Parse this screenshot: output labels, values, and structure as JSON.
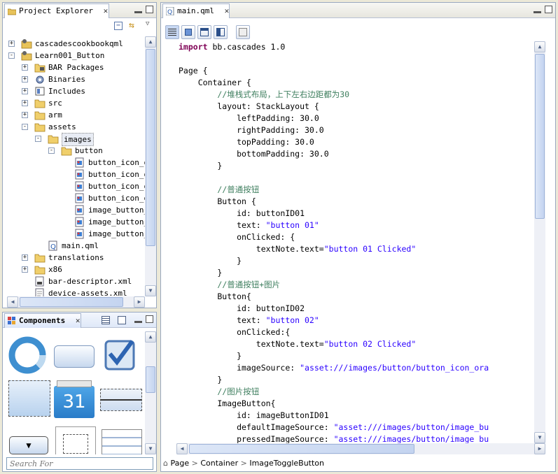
{
  "project_explorer": {
    "tab_label": "Project Explorer",
    "tree": [
      {
        "label": "cascadescookbookqml",
        "indent": 0,
        "expander": "+",
        "icon": "project-icon"
      },
      {
        "label": "Learn001_Button",
        "indent": 0,
        "expander": "-",
        "icon": "project-icon"
      },
      {
        "label": "BAR Packages",
        "indent": 1,
        "expander": "+",
        "icon": "bar-packages-icon"
      },
      {
        "label": "Binaries",
        "indent": 1,
        "expander": "+",
        "icon": "binaries-icon"
      },
      {
        "label": "Includes",
        "indent": 1,
        "expander": "+",
        "icon": "includes-icon"
      },
      {
        "label": "src",
        "indent": 1,
        "expander": "+",
        "icon": "folder-icon"
      },
      {
        "label": "arm",
        "indent": 1,
        "expander": "+",
        "icon": "folder-icon"
      },
      {
        "label": "assets",
        "indent": 1,
        "expander": "-",
        "icon": "folder-icon"
      },
      {
        "label": "images",
        "indent": 2,
        "expander": "-",
        "icon": "folder-icon",
        "selected": true
      },
      {
        "label": "button",
        "indent": 3,
        "expander": "-",
        "icon": "folder-icon"
      },
      {
        "label": "button_icon_or",
        "indent": 4,
        "expander": "",
        "icon": "image-file-icon"
      },
      {
        "label": "button_icon_or",
        "indent": 4,
        "expander": "",
        "icon": "image-file-icon"
      },
      {
        "label": "button_icon_or",
        "indent": 4,
        "expander": "",
        "icon": "image-file-icon"
      },
      {
        "label": "button_icon_or",
        "indent": 4,
        "expander": "",
        "icon": "image-file-icon"
      },
      {
        "label": "image_button_c",
        "indent": 4,
        "expander": "",
        "icon": "image-file-icon"
      },
      {
        "label": "image_button_c",
        "indent": 4,
        "expander": "",
        "icon": "image-file-icon"
      },
      {
        "label": "image_button_s",
        "indent": 4,
        "expander": "",
        "icon": "image-file-icon"
      },
      {
        "label": "main.qml",
        "indent": 2,
        "expander": "",
        "icon": "qml-file-icon"
      },
      {
        "label": "translations",
        "indent": 1,
        "expander": "+",
        "icon": "folder-icon"
      },
      {
        "label": "x86",
        "indent": 1,
        "expander": "+",
        "icon": "folder-icon"
      },
      {
        "label": "bar-descriptor.xml",
        "indent": 1,
        "expander": "",
        "icon": "xml-file-icon"
      },
      {
        "label": "device-assets.xml",
        "indent": 1,
        "expander": "",
        "icon": "file-icon"
      }
    ]
  },
  "components": {
    "tab_label": "Components",
    "search_placeholder": "Search For",
    "items": [
      "activity-indicator",
      "button",
      "checkbox",
      "container",
      "date-time-picker",
      "divider",
      "drop-down",
      "empty",
      "list-view"
    ],
    "calendar_day": "31"
  },
  "editor": {
    "tab_label": "main.qml",
    "breadcrumb": [
      "Page",
      "Container",
      "ImageToggleButton"
    ],
    "lines": [
      [
        {
          "t": "import",
          "c": "kw"
        },
        {
          "t": " bb.cascades 1.0"
        }
      ],
      [],
      [
        {
          "t": "Page {"
        }
      ],
      [
        {
          "t": "    Container {"
        }
      ],
      [
        {
          "t": "        "
        },
        {
          "t": "//堆栈式布局，上下左右边距都为30",
          "c": "cm"
        }
      ],
      [
        {
          "t": "        layout: StackLayout {"
        }
      ],
      [
        {
          "t": "            leftPadding: 30.0"
        }
      ],
      [
        {
          "t": "            rightPadding: 30.0"
        }
      ],
      [
        {
          "t": "            topPadding: 30.0"
        }
      ],
      [
        {
          "t": "            bottomPadding: 30.0"
        }
      ],
      [
        {
          "t": "        }"
        }
      ],
      [],
      [
        {
          "t": "        "
        },
        {
          "t": "//普通按钮",
          "c": "cm"
        }
      ],
      [
        {
          "t": "        Button {"
        }
      ],
      [
        {
          "t": "            id: buttonID01"
        }
      ],
      [
        {
          "t": "            text: "
        },
        {
          "t": "\"button 01\"",
          "c": "str"
        }
      ],
      [
        {
          "t": "            onClicked: {"
        }
      ],
      [
        {
          "t": "                textNote.text="
        },
        {
          "t": "\"button 01 Clicked\"",
          "c": "str"
        }
      ],
      [
        {
          "t": "            }"
        }
      ],
      [
        {
          "t": "        }"
        }
      ],
      [
        {
          "t": "        "
        },
        {
          "t": "//普通按钮+图片",
          "c": "cm"
        }
      ],
      [
        {
          "t": "        Button{"
        }
      ],
      [
        {
          "t": "            id: buttonID02"
        }
      ],
      [
        {
          "t": "            text: "
        },
        {
          "t": "\"button 02\"",
          "c": "str"
        }
      ],
      [
        {
          "t": "            onClicked:{"
        }
      ],
      [
        {
          "t": "                textNote.text="
        },
        {
          "t": "\"button 02 Clicked\"",
          "c": "str"
        }
      ],
      [
        {
          "t": "            }"
        }
      ],
      [
        {
          "t": "            imageSource: "
        },
        {
          "t": "\"asset:///images/button/button_icon_ora",
          "c": "str"
        }
      ],
      [
        {
          "t": "        }"
        }
      ],
      [
        {
          "t": "        "
        },
        {
          "t": "//图片按钮",
          "c": "cm"
        }
      ],
      [
        {
          "t": "        ImageButton{"
        }
      ],
      [
        {
          "t": "            id: imageButtonID01"
        }
      ],
      [
        {
          "t": "            defaultImageSource: "
        },
        {
          "t": "\"asset:///images/button/image_bu",
          "c": "str"
        }
      ],
      [
        {
          "t": "            pressedImageSource: "
        },
        {
          "t": "\"asset:///images/button/image_bu",
          "c": "str"
        }
      ]
    ]
  },
  "colors": {
    "keyword": "#7f0055",
    "string": "#2a00ff",
    "comment": "#3f7f5f",
    "accent": "#6d8fc6"
  }
}
